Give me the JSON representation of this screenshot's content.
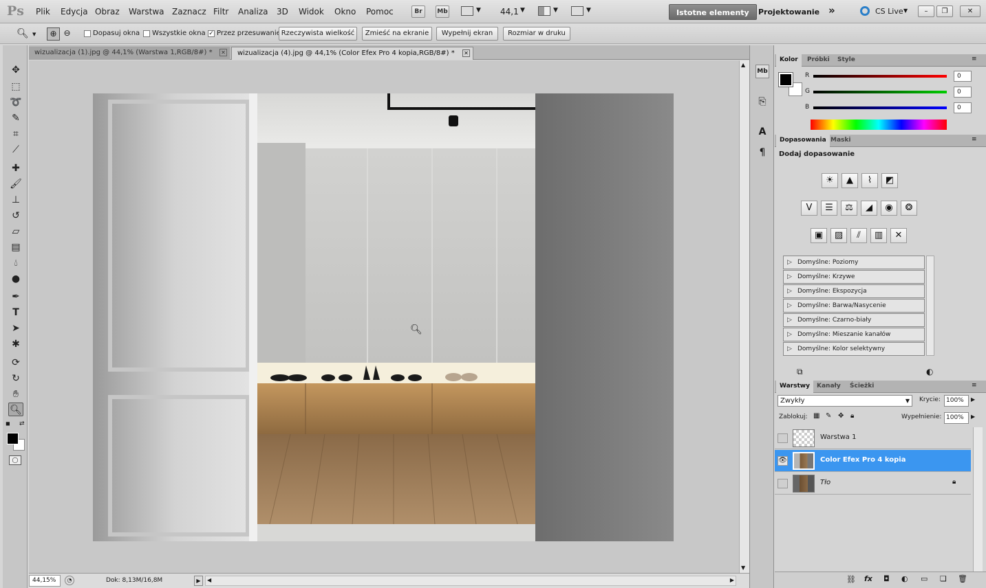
{
  "menu": {
    "logo": "Ps",
    "items": [
      "Plik",
      "Edycja",
      "Obraz",
      "Warstwa",
      "Zaznacz",
      "Filtr",
      "Analiza",
      "3D",
      "Widok",
      "Okno",
      "Pomoc"
    ],
    "bridge": "Br",
    "minibridge": "Mb",
    "zoom": "44,1",
    "workspace_active": "Istotne elementy",
    "workspace_other": "Projektowanie",
    "more": "»",
    "cslive": "CS Live"
  },
  "options": {
    "fit_windows": "Dopasuj okna",
    "all_windows": "Wszystkie okna",
    "scrubby": "Przez przesuwanie",
    "actual_pixels": "Rzeczywista wielkość",
    "fit_screen": "Zmieść na ekranie",
    "fill_screen": "Wypełnij ekran",
    "print_size": "Rozmiar w druku"
  },
  "tabs": [
    {
      "label": "wizualizacja (1).jpg @ 44,1% (Warstwa 1,RGB/8#) *"
    },
    {
      "label": "wizualizacja (4).jpg @ 44,1% (Color Efex Pro 4 kopia,RGB/8#) *"
    }
  ],
  "status": {
    "zoom": "44,15%",
    "doc": "Dok: 8,13M/16,8M"
  },
  "color_panel": {
    "tabs": [
      "Kolor",
      "Próbki",
      "Style"
    ],
    "channels": [
      {
        "label": "R",
        "value": "0"
      },
      {
        "label": "G",
        "value": "0"
      },
      {
        "label": "B",
        "value": "0"
      }
    ]
  },
  "adjust_panel": {
    "tabs": [
      "Dopasowania",
      "Maski"
    ],
    "title": "Dodaj dopasowanie",
    "presets": [
      "Domyślne: Poziomy",
      "Domyślne: Krzywe",
      "Domyślne: Ekspozycja",
      "Domyślne: Barwa/Nasycenie",
      "Domyślne: Czarno-biały",
      "Domyślne: Mieszanie kanałów",
      "Domyślne: Kolor selektywny"
    ]
  },
  "layers_panel": {
    "tabs": [
      "Warstwy",
      "Kanały",
      "Ścieżki"
    ],
    "blend_mode": "Zwykły",
    "opacity_label": "Krycie:",
    "opacity": "100%",
    "lock_label": "Zablokuj:",
    "fill_label": "Wypełnienie:",
    "fill": "100%",
    "layers": [
      {
        "name": "Warstwa 1"
      },
      {
        "name": "Color Efex Pro 4 kopia"
      },
      {
        "name": "Tło"
      }
    ]
  },
  "colors": {
    "selected_layer": "#3b96f0",
    "workspace_active_bg": "#7a7a7a"
  }
}
